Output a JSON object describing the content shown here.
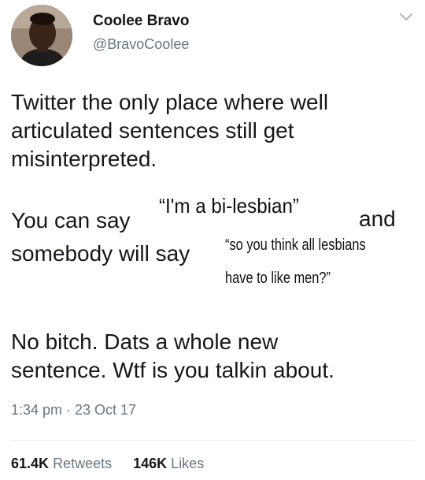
{
  "tweet": {
    "author": {
      "display_name": "Coolee Bravo",
      "handle": "@BravoCoolee",
      "avatar_icon": "profile-photo"
    },
    "paragraph1": [
      "Twitter the only place where well",
      "articulated sentences still get",
      "misinterpreted."
    ],
    "paragraph2": {
      "line1_prefix": "You can say",
      "quote1": "“I'm a bi-lesbian”",
      "line1_suffix": "and",
      "line2_prefix": "somebody will say",
      "quote2_line1": "“so you think all lesbians",
      "quote2_line2": "have to like men?”"
    },
    "paragraph3": [
      "No bitch. Dats a whole new",
      "sentence. Wtf is you talkin about."
    ],
    "timestamp": "1:34 pm · 23 Oct 17",
    "stats": {
      "retweets_count": "61.4K",
      "retweets_label": "Retweets",
      "likes_count": "146K",
      "likes_label": "Likes"
    },
    "menu_icon": "chevron-down-icon"
  },
  "colors": {
    "text": "#14171a",
    "secondary": "#657786",
    "divider": "#e1e8ed"
  }
}
